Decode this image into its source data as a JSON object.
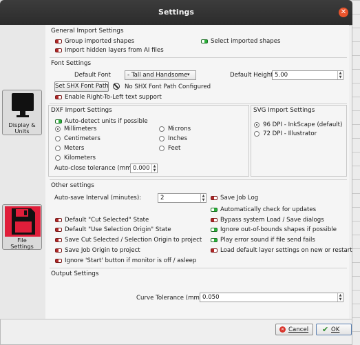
{
  "window": {
    "title": "Settings"
  },
  "sidebar": {
    "items": [
      {
        "label_line1": "Display &",
        "label_line2": "Units",
        "icon": "monitor-icon"
      },
      {
        "label_line1": "File",
        "label_line2": "Settings",
        "icon": "floppy-disk-icon"
      }
    ]
  },
  "general_import": {
    "title": "General Import Settings",
    "group_imported_shapes": "Group imported shapes",
    "import_hidden_layers": "Import hidden layers from AI files",
    "select_imported_shapes": "Select imported shapes"
  },
  "font": {
    "title": "Font Settings",
    "default_font_label": "Default Font",
    "default_font_value": "- Tall and Handsome",
    "default_height_label": "Default Height",
    "default_height_value": "5.00",
    "set_shx_button": "Set SHX Font Path",
    "no_shx_text": "No SHX Font Path Configured",
    "rtl_label": "Enable Right-To-Left text support"
  },
  "dxf": {
    "title": "DXF Import Settings",
    "auto_detect": "Auto-detect units if possible",
    "units": [
      "Millimeters",
      "Centimeters",
      "Meters",
      "Kilometers",
      "Microns",
      "Inches",
      "Feet"
    ],
    "selected_unit": "Millimeters",
    "auto_close_label": "Auto-close tolerance (mm)",
    "auto_close_value": "0.000"
  },
  "svg": {
    "title": "SVG Import Settings",
    "options": [
      "96 DPI - InkScape (default)",
      "72 DPI - Illustrator"
    ],
    "selected": "96 DPI - InkScape (default)"
  },
  "other": {
    "title": "Other settings",
    "autosave_label": "Auto-save Interval (minutes):",
    "autosave_value": "2",
    "save_job_log": "Save Job Log",
    "auto_check_updates": "Automatically check for updates",
    "default_cut_selected": "Default \"Cut Selected\" State",
    "bypass_dialogs": "Bypass system Load / Save dialogs",
    "default_use_selection_origin": "Default \"Use Selection Origin\" State",
    "ignore_oob": "Ignore out-of-bounds shapes if possible",
    "save_cut_selected": "Save Cut Selected / Selection Origin to project",
    "play_error_sound": "Play error sound if file send fails",
    "save_job_origin": "Save Job Origin to project",
    "load_default_layer": "Load default layer settings on new or restart",
    "ignore_start": "Ignore 'Start' button if monitor is off / asleep"
  },
  "output": {
    "title": "Output Settings",
    "curve_tolerance_label": "Curve Tolerance (mm)",
    "curve_tolerance_value": "0.050"
  },
  "footer": {
    "cancel": "Cancel",
    "ok": "OK"
  },
  "colors": {
    "toggle_off": "#b02626",
    "toggle_on": "#2bb33a",
    "sidebar_active": "#e01e3a"
  }
}
